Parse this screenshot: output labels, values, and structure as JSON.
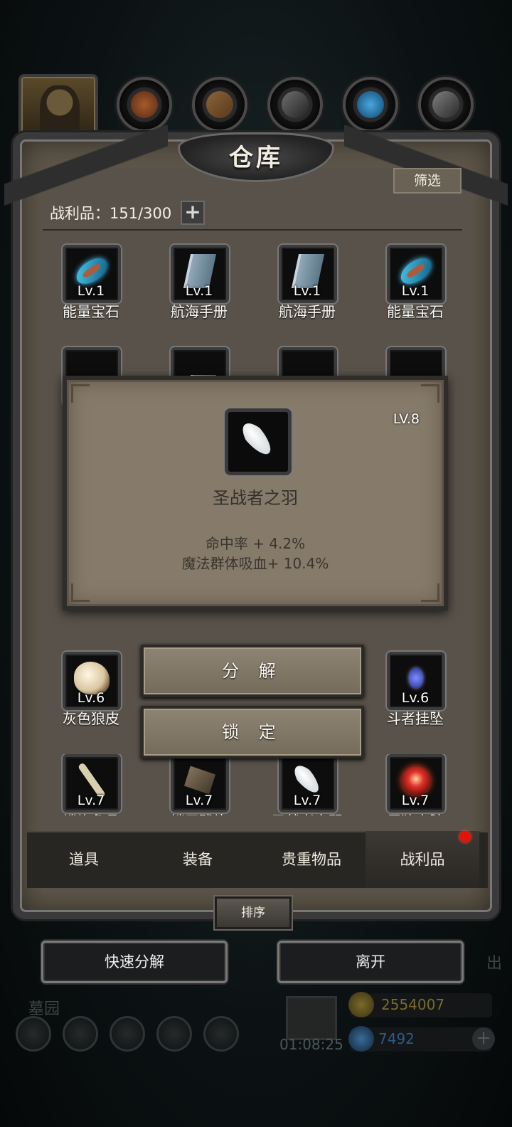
{
  "window": {
    "title": "仓库"
  },
  "filter_label": "筛选",
  "capacity": {
    "label": "战利品：151/300",
    "add_icon": "plus-icon"
  },
  "grid_rows": [
    [
      {
        "level": "Lv.1",
        "name": "能量宝石",
        "icon": "energy-gem-icon"
      },
      {
        "level": "Lv.1",
        "name": "航海手册",
        "icon": "navigation-manual-icon"
      },
      {
        "level": "Lv.1",
        "name": "航海手册",
        "icon": "navigation-manual-icon"
      },
      {
        "level": "Lv.1",
        "name": "能量宝石",
        "icon": "energy-gem-icon"
      }
    ],
    [
      {
        "level": "Lv.6",
        "name": "灰色狼皮",
        "icon": "grey-wolf-pelt-icon"
      },
      {
        "level": "Lv.6",
        "name": "斗者挂坠",
        "icon": "fighter-pendant-icon"
      }
    ],
    [
      {
        "level": "Lv.7",
        "name": "嶙峋角骨",
        "icon": "horn-bone-icon"
      },
      {
        "level": "Lv.7",
        "name": "锁甲残片",
        "icon": "chainmail-fragment-icon"
      },
      {
        "level": "Lv.7",
        "name": "圣战者之羽",
        "icon": "crusader-feather-icon"
      },
      {
        "level": "Lv.7",
        "name": "巨狼内脏",
        "icon": "giant-wolf-viscera-icon"
      }
    ]
  ],
  "popup": {
    "item_name": "圣战者之羽",
    "level": "LV.8",
    "icon": "feather-icon",
    "stats": [
      "命中率 + 4.2%",
      "魔法群体吸血+ 10.4%"
    ]
  },
  "actions": {
    "decompose": "分 解",
    "lock": "锁 定"
  },
  "tabs": [
    {
      "label": "道具"
    },
    {
      "label": "装备"
    },
    {
      "label": "贵重物品"
    },
    {
      "label": "战利品",
      "active": true
    }
  ],
  "sort_label": "排序",
  "bottom_buttons": {
    "quick_decompose": "快速分解",
    "leave": "离开"
  },
  "background_hud": {
    "location": "墓园",
    "timer": "01:08:25",
    "gold": "2554007",
    "gems": "7492",
    "right_edge_text": "出"
  },
  "colors": {
    "panel": "#5e5649",
    "popup": "#867b6a",
    "notification_dot": "#e3120a",
    "gold_text": "#7a6a2c",
    "gem_text": "#2e5a86"
  }
}
